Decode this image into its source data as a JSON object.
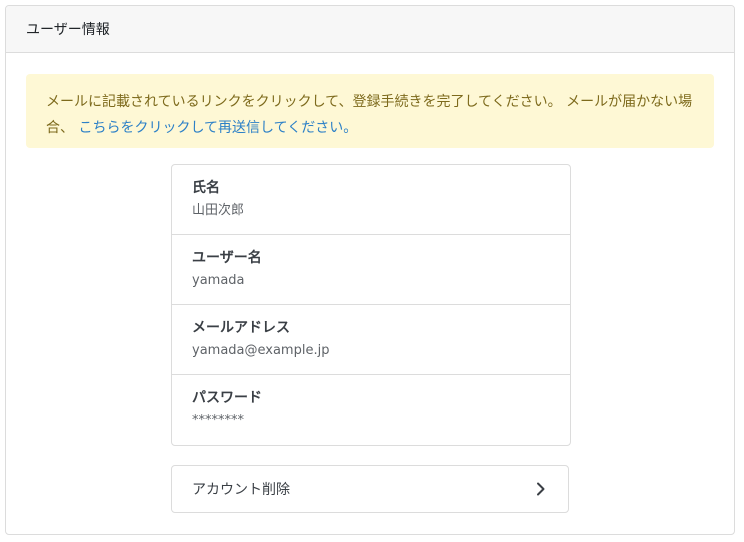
{
  "header": {
    "title": "ユーザー情報"
  },
  "alert": {
    "text": "メールに記載されているリンクをクリックして、登録手続きを完了してください。 メールが届かない場合、",
    "link_text": "こちらをクリックして再送信してください。"
  },
  "profile": {
    "items": [
      {
        "label": "氏名",
        "value": "山田次郎"
      },
      {
        "label": "ユーザー名",
        "value": "yamada"
      },
      {
        "label": "メールアドレス",
        "value": "yamada@example.jp"
      },
      {
        "label": "パスワード",
        "value": "********"
      }
    ]
  },
  "account_delete": {
    "label": "アカウント削除",
    "icon": "chevron-right-icon"
  },
  "colors": {
    "alert_background": "#fef8d5",
    "alert_text": "#7d6a1c",
    "link": "#2c80c7",
    "header_background": "#f7f7f7",
    "border": "#dcdcdc"
  }
}
